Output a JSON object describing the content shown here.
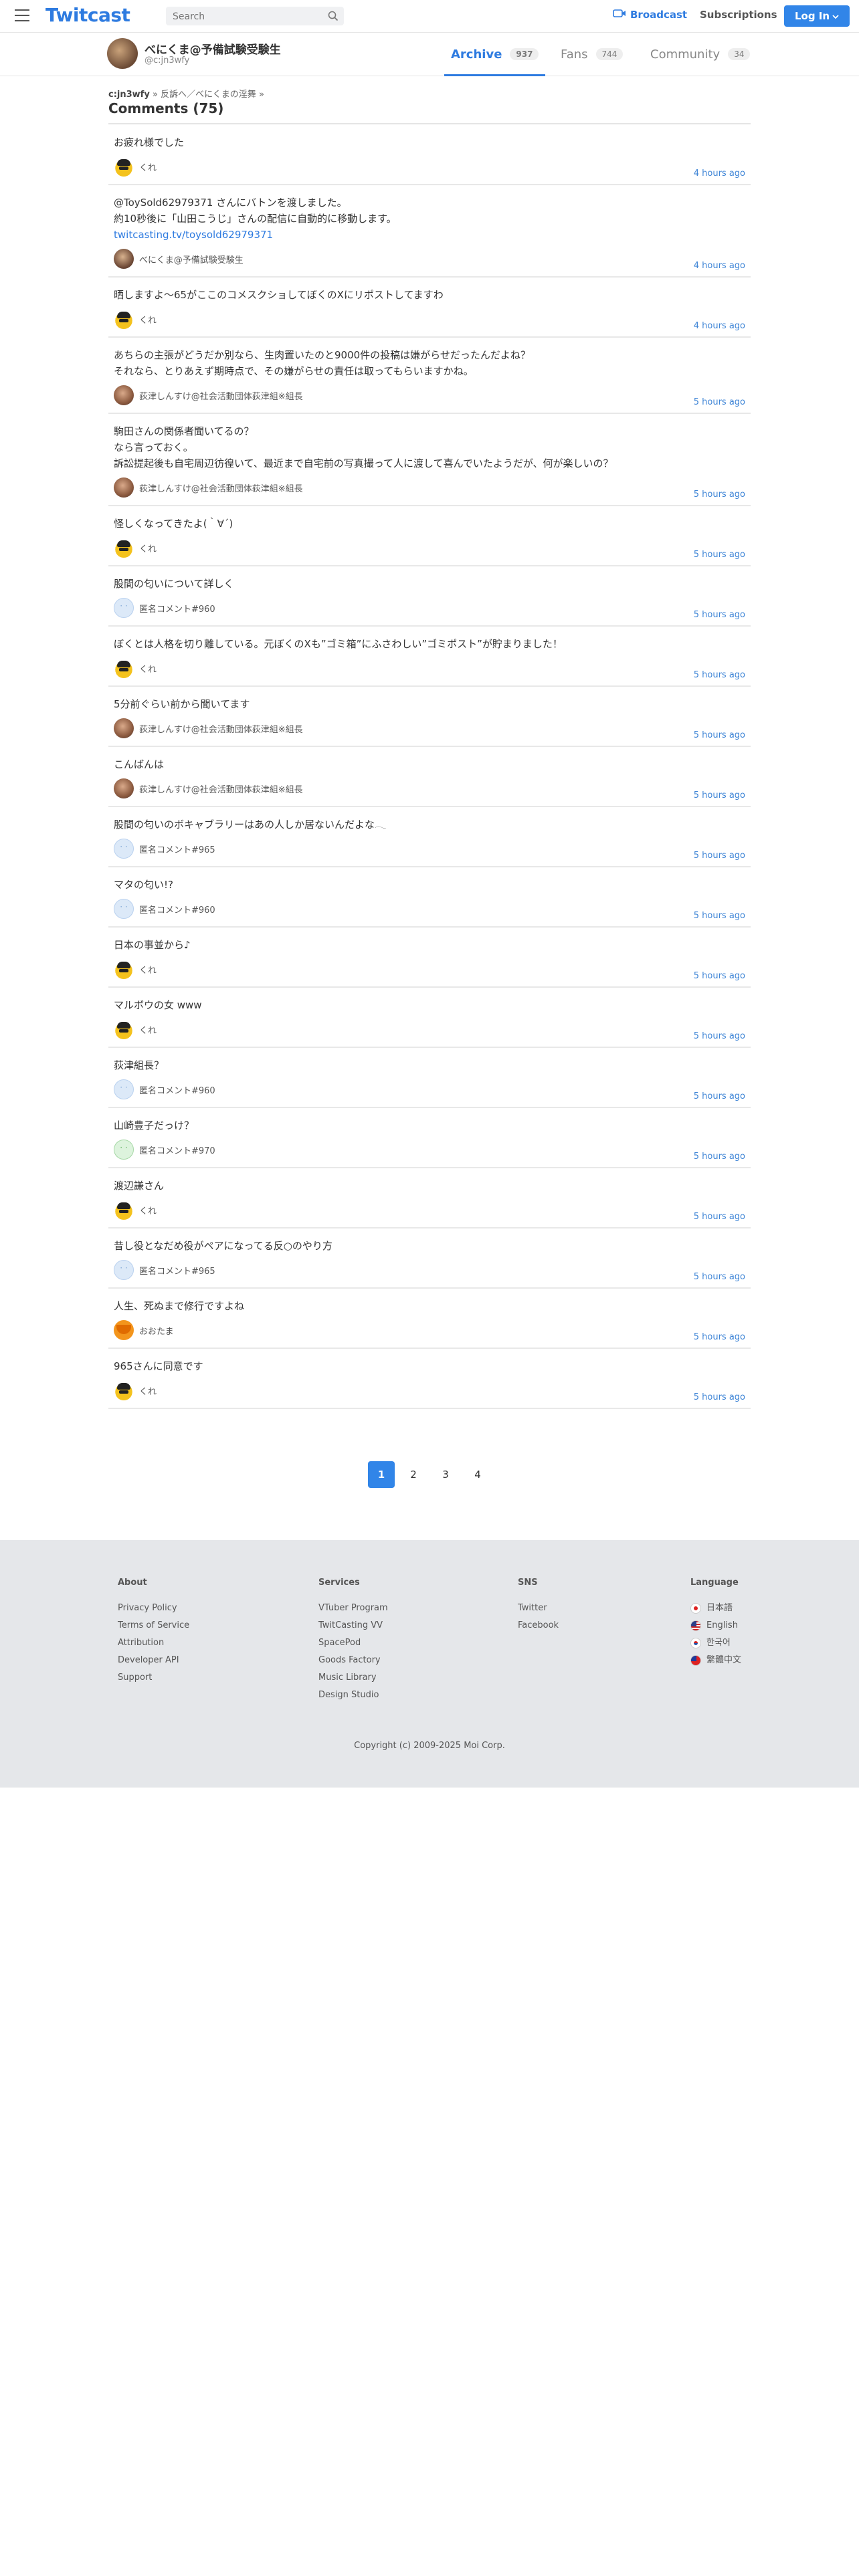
{
  "header": {
    "logo": "Twitcast",
    "search_placeholder": "Search",
    "broadcast": "Broadcast",
    "subscriptions": "Subscriptions",
    "login": "Log In"
  },
  "profile": {
    "name": "べにくま@予備試験受験生",
    "id": "@c:jn3wfy",
    "tabs": [
      {
        "label": "Archive",
        "count": "937"
      },
      {
        "label": "Fans",
        "count": "744"
      },
      {
        "label": "Community",
        "count": "34"
      }
    ]
  },
  "breadcrumb": {
    "user": "c:jn3wfy",
    "sep": "»",
    "movie": "反訴へ／べにくまの淫舞",
    "trail": "»"
  },
  "page_title": "Comments (75)",
  "comments": [
    {
      "text": "お疲れ様でした",
      "user": "くれ",
      "avatar": "kure",
      "time": "4 hours ago"
    },
    {
      "text": "@ToySold62979371 さんにバトンを渡しました。\n約10秒後に「山田こうじ」さんの配信に自動的に移動します。",
      "link": "twitcasting.tv/toysold62979371",
      "user": "べにくま@予備試験受験生",
      "avatar": "bear",
      "time": "4 hours ago"
    },
    {
      "text": "晒しますよ〜65がここのコメスクショしてぼくのXにリポストしてますわ",
      "user": "くれ",
      "avatar": "kure",
      "time": "4 hours ago"
    },
    {
      "text": "あちらの主張がどうだか別なら、生肉置いたのと9000件の投稿は嫌がらせだったんだよね？\nそれなら、とりあえず期時点で、その嫌がらせの責任は取ってもらいますかね。",
      "user": "荻津しんすけ@社会活動団体荻津組※組長",
      "avatar": "kinno",
      "time": "5 hours ago"
    },
    {
      "text": "駒田さんの関係者聞いてるの？\nなら言っておく。\n訴訟提起後も自宅周辺彷徨いて、最近まで自宅前の写真撮って人に渡して喜んでいたようだが、何が楽しいの？",
      "user": "荻津しんすけ@社会活動団体荻津組※組長",
      "avatar": "kinno",
      "time": "5 hours ago"
    },
    {
      "text": "怪しくなってきたよ(｀∀´)",
      "user": "くれ",
      "avatar": "kure",
      "time": "5 hours ago"
    },
    {
      "text": "股間の匂いについて詳しく",
      "user": "匿名コメント#960",
      "avatar": "anon",
      "time": "5 hours ago"
    },
    {
      "text": "ぼくとは人格を切り離している。元ぼくのXも”ゴミ箱”にふさわしい”ゴミポスト”が貯まりました！",
      "user": "くれ",
      "avatar": "kure",
      "time": "5 hours ago"
    },
    {
      "text": "5分前ぐらい前から聞いてます",
      "user": "荻津しんすけ@社会活動団体荻津組※組長",
      "avatar": "kinno",
      "time": "5 hours ago"
    },
    {
      "text": "こんばんは",
      "user": "荻津しんすけ@社会活動団体荻津組※組長",
      "avatar": "kinno",
      "time": "5 hours ago"
    },
    {
      "text": "股間の匂いのボキャブラリーはあの人しか居ないんだよな𓂃",
      "user": "匿名コメント#965",
      "avatar": "anon",
      "time": "5 hours ago"
    },
    {
      "text": "マタの匂い!?",
      "user": "匿名コメント#960",
      "avatar": "anon",
      "time": "5 hours ago"
    },
    {
      "text": "日本の事並から♪",
      "user": "くれ",
      "avatar": "kure",
      "time": "5 hours ago"
    },
    {
      "text": "マルボウの女 www",
      "user": "くれ",
      "avatar": "kure",
      "time": "5 hours ago"
    },
    {
      "text": "荻津組長？",
      "user": "匿名コメント#960",
      "avatar": "anon",
      "time": "5 hours ago"
    },
    {
      "text": "山崎豊子だっけ？",
      "user": "匿名コメント#970",
      "avatar": "anon2",
      "time": "5 hours ago"
    },
    {
      "text": "渡辺謙さん",
      "user": "くれ",
      "avatar": "kure",
      "time": "5 hours ago"
    },
    {
      "text": "昔し役となだめ役がペアになってる反○のやり方",
      "user": "匿名コメント#965",
      "avatar": "anon",
      "time": "5 hours ago"
    },
    {
      "text": "人生、死ぬまで修行ですよね",
      "user": "おおたま",
      "avatar": "odata",
      "time": "5 hours ago"
    },
    {
      "text": "965さんに同意です",
      "user": "くれ",
      "avatar": "kure",
      "time": "5 hours ago"
    }
  ],
  "pagination": [
    "1",
    "2",
    "3",
    "4"
  ],
  "pagination_current": "1",
  "footer": {
    "about": {
      "title": "About",
      "items": [
        "Privacy Policy",
        "Terms of Service",
        "Attribution",
        "Developer API",
        "Support"
      ]
    },
    "services": {
      "title": "Services",
      "items": [
        "VTuber Program",
        "TwitCasting VV",
        "SpacePod",
        "Goods Factory",
        "Music Library",
        "Design Studio"
      ]
    },
    "sns": {
      "title": "SNS",
      "items": [
        "Twitter",
        "Facebook"
      ]
    },
    "language": {
      "title": "Language",
      "items": [
        {
          "label": "日本語",
          "flag": "jp"
        },
        {
          "label": "English",
          "flag": "us"
        },
        {
          "label": "한국어",
          "flag": "kr"
        },
        {
          "label": "繁體中文",
          "flag": "tw"
        }
      ]
    },
    "copyright": "Copyright (c) 2009-2025 Moi Corp."
  }
}
